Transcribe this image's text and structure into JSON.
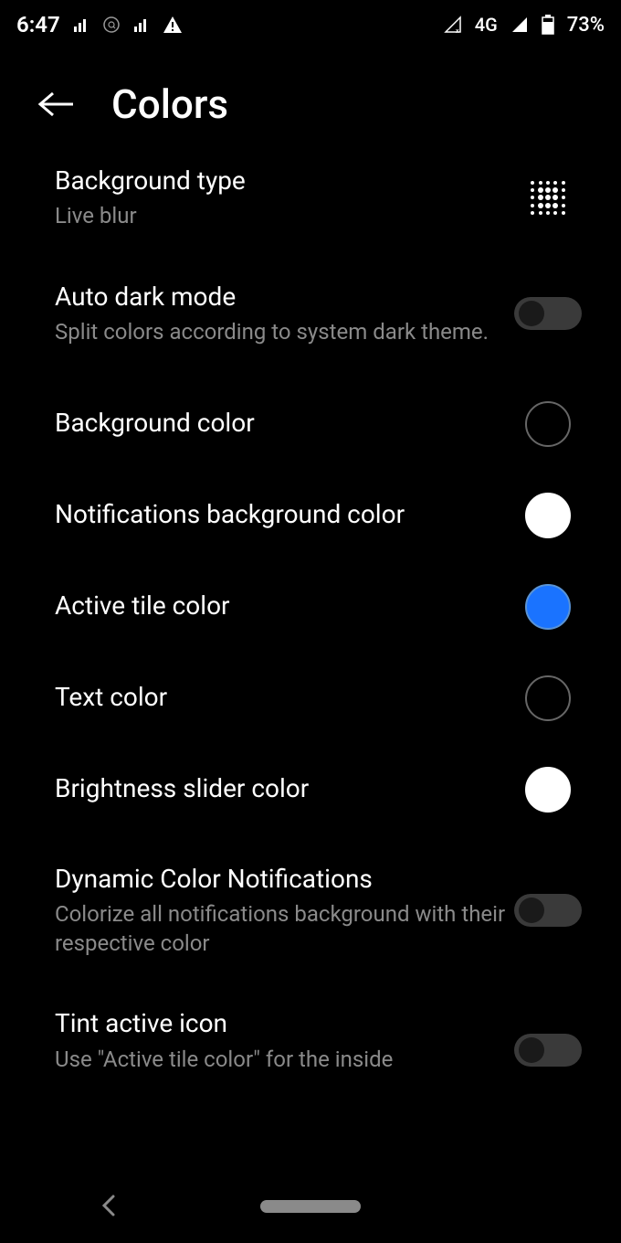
{
  "status": {
    "time": "6:47",
    "network": "4G",
    "battery": "73%"
  },
  "header": {
    "title": "Colors"
  },
  "settings": {
    "bgType": {
      "title": "Background type",
      "subtitle": "Live blur"
    },
    "autoDark": {
      "title": "Auto dark mode",
      "subtitle": "Split colors according to system dark theme."
    },
    "bgColor": {
      "title": "Background color",
      "swatch": "#000000"
    },
    "notifBgColor": {
      "title": "Notifications background color",
      "swatch": "#ffffff"
    },
    "activeTile": {
      "title": "Active tile color",
      "swatch": "#1a73ff"
    },
    "textColor": {
      "title": "Text color",
      "swatch": "#000000"
    },
    "brightness": {
      "title": "Brightness slider color",
      "swatch": "#ffffff"
    },
    "dynamic": {
      "title": "Dynamic Color Notifications",
      "subtitle": "Colorize all notifications background with their respective color"
    },
    "tint": {
      "title": "Tint active icon",
      "subtitle": "Use \"Active tile color\" for the inside"
    }
  }
}
